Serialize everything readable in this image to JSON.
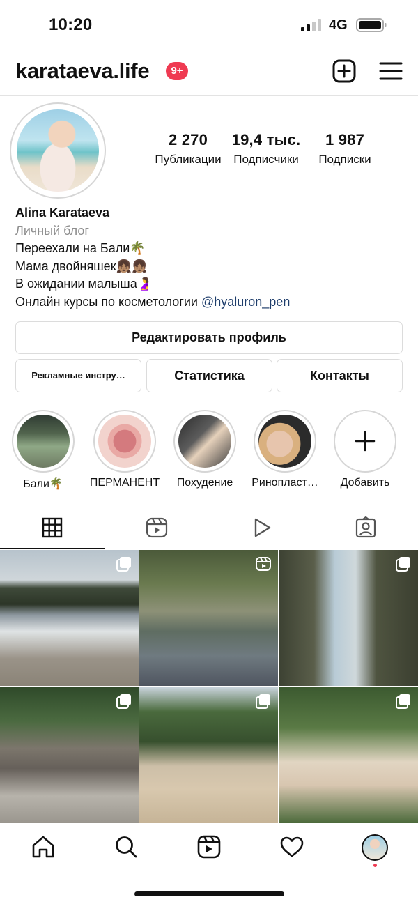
{
  "status_bar": {
    "time": "10:20",
    "network": "4G"
  },
  "header": {
    "username": "karataeva.life",
    "notifications_badge": "9+"
  },
  "stats": {
    "posts": {
      "value": "2 270",
      "label": "Публикации"
    },
    "followers": {
      "value": "19,4 тыс.",
      "label": "Подписчики"
    },
    "following": {
      "value": "1 987",
      "label": "Подписки"
    }
  },
  "bio": {
    "name": "Alina Karataeva",
    "category": "Личный блог",
    "lines": [
      "Переехали на Бали🌴",
      "Мама двойняшек👧🏽👧🏽",
      "В ожидании малыша🤰"
    ],
    "last_line_text": "Онлайн курсы по косметологии ",
    "last_line_link": "@hyaluron_pen"
  },
  "buttons": {
    "edit_profile": "Редактировать профиль",
    "ad_tools": "Рекламные инстру…",
    "statistics": "Статистика",
    "contacts": "Контакты"
  },
  "highlights": [
    {
      "label": "Бали🌴"
    },
    {
      "label": "ПЕРМАНЕНТ"
    },
    {
      "label": "Похудение"
    },
    {
      "label": "Ринопласт…"
    },
    {
      "label": "Добавить"
    }
  ],
  "tabs": [
    {
      "icon": "grid-icon",
      "active": true
    },
    {
      "icon": "reels-icon",
      "active": false
    },
    {
      "icon": "play-icon",
      "active": false
    },
    {
      "icon": "tagged-icon",
      "active": false
    }
  ],
  "posts": [
    {
      "type": "carousel"
    },
    {
      "type": "reel"
    },
    {
      "type": "carousel"
    },
    {
      "type": "carousel"
    },
    {
      "type": "carousel"
    },
    {
      "type": "carousel"
    }
  ],
  "nav": [
    "home-icon",
    "search-icon",
    "reels-icon",
    "activity-heart-icon",
    "profile-avatar"
  ],
  "colors": {
    "badge": "#ef3a52",
    "link": "#1e3d6b",
    "muted": "#8e8e8e"
  }
}
